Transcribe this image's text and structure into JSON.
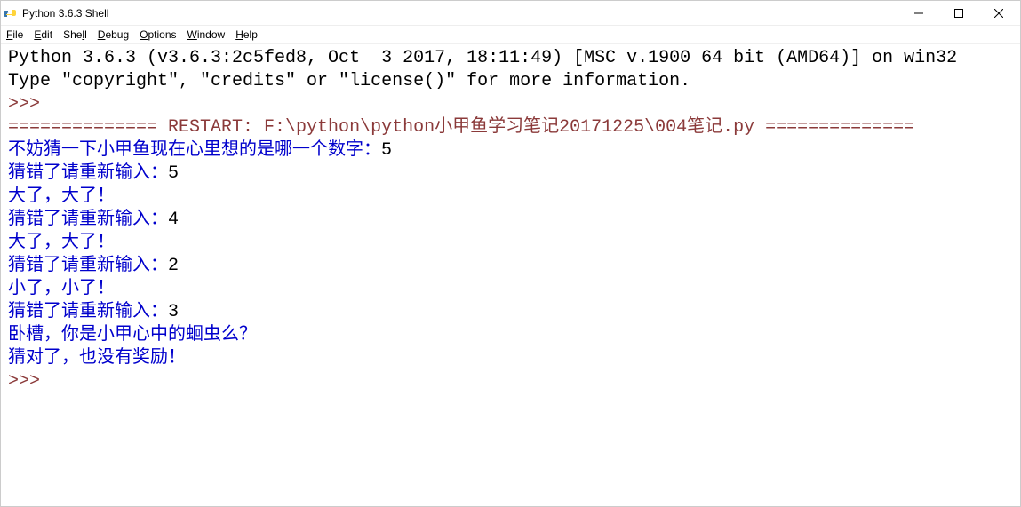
{
  "window": {
    "title": "Python 3.6.3 Shell"
  },
  "menu": {
    "file": "File",
    "edit": "Edit",
    "shell": "Shell",
    "debug": "Debug",
    "options": "Options",
    "window": "Window",
    "help": "Help"
  },
  "console": {
    "banner1": "Python 3.6.3 (v3.6.3:2c5fed8, Oct  3 2017, 18:11:49) [MSC v.1900 64 bit (AMD64)] on win32",
    "banner2": "Type \"copyright\", \"credits\" or \"license()\" for more information.",
    "prompt": ">>> ",
    "restart": "============== RESTART: F:\\python\\python小甲鱼学习笔记20171225\\004笔记.py ==============",
    "line_guess_prompt": "不妨猜一下小甲鱼现在心里想的是哪一个数字：",
    "guess1": "5",
    "line_wrong_retry": "猜错了请重新输入：",
    "retry1": "5",
    "line_too_big": "大了，大了！",
    "retry2": "4",
    "retry3": "2",
    "line_too_small": "小了，小了！",
    "retry4": "3",
    "line_win1": "卧槽，你是小甲心中的蛔虫么？",
    "line_win2": "猜对了，也没有奖励！"
  }
}
